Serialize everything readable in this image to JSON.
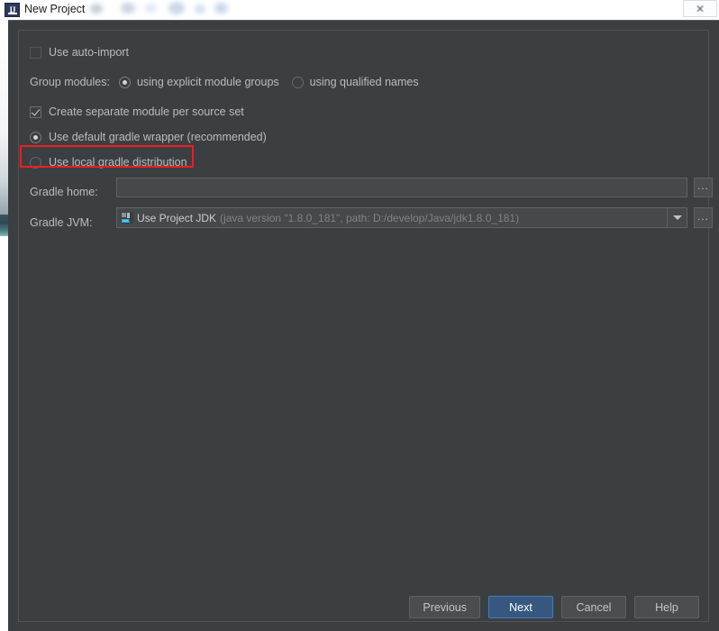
{
  "window": {
    "title": "New Project",
    "title_icon": "intellij-idea-icon",
    "close_label": "✕"
  },
  "form": {
    "auto_import": {
      "label": "Use auto-import",
      "checked": false
    },
    "group_modules": {
      "label": "Group modules:",
      "options": [
        {
          "label": "using explicit module groups",
          "selected": true
        },
        {
          "label": "using qualified names",
          "selected": false
        }
      ]
    },
    "separate_module": {
      "label": "Create separate module per source set",
      "checked": true
    },
    "gradle_distribution": {
      "options": [
        {
          "label": "Use default gradle wrapper (recommended)",
          "selected": true
        },
        {
          "label": "Use local gradle distribution",
          "selected": false
        }
      ]
    },
    "gradle_home": {
      "label": "Gradle home:",
      "value": "",
      "placeholder": "",
      "browse_label": "..."
    },
    "gradle_jvm": {
      "label": "Gradle JVM:",
      "icon": "jdk-icon",
      "value": "Use Project JDK",
      "detail": "(java version \"1.8.0_181\", path: D:/develop/Java/jdk1.8.0_181)",
      "browse_label": "...",
      "dropdown_icon": "chevron-down-icon"
    }
  },
  "annotation": {
    "color": "#ee1c25",
    "target": "Use local gradle distribution"
  },
  "buttons": [
    {
      "label": "Previous",
      "default": false
    },
    {
      "label": "Next",
      "default": true
    },
    {
      "label": "Cancel",
      "default": false
    },
    {
      "label": "Help",
      "default": false
    }
  ],
  "colors": {
    "panel_bg": "#3c3f41",
    "field_bg": "#45494a",
    "text": "#bbbbbb",
    "accent_button": "#365880",
    "annotation": "#ee1c25"
  }
}
